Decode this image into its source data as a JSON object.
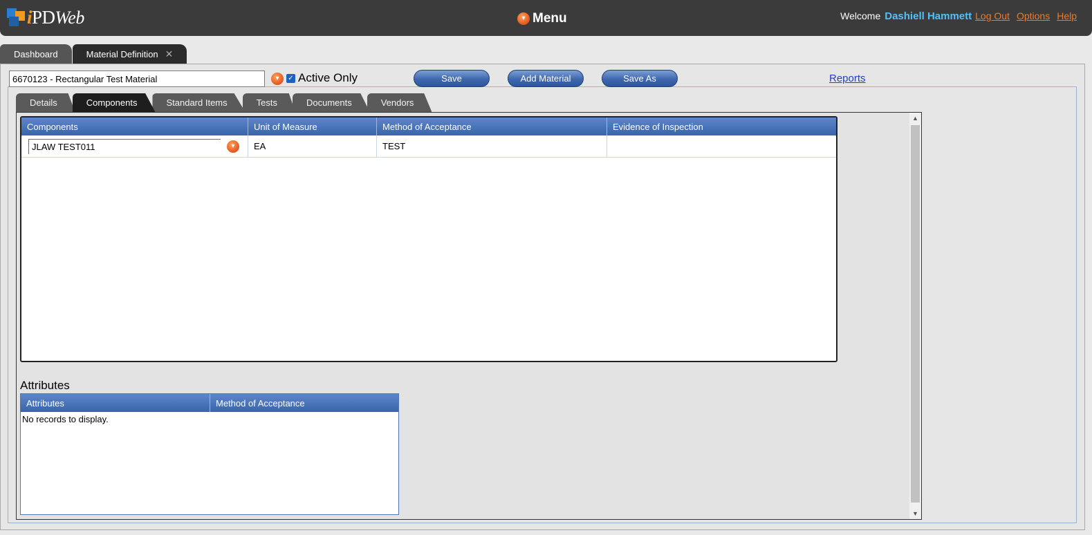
{
  "header": {
    "logo_i": "i",
    "logo_pd": "PD",
    "logo_web": "Web",
    "menu_label": "Menu",
    "welcome_label": "Welcome",
    "user_name": "Dashiell Hammett",
    "links": {
      "logout": "Log Out",
      "options": "Options",
      "help": "Help"
    }
  },
  "top_tabs": [
    {
      "label": "Dashboard",
      "active": false
    },
    {
      "label": "Material Definition",
      "active": true,
      "close": "✕"
    }
  ],
  "toolbar": {
    "material_value": "6670123 - Rectangular Test Material",
    "active_only_label": "Active Only",
    "active_only_checked": true,
    "save_label": "Save",
    "add_material_label": "Add Material",
    "save_as_label": "Save As",
    "reports_label": "Reports"
  },
  "sub_tabs": [
    {
      "label": "Details",
      "active": false
    },
    {
      "label": "Components",
      "active": true
    },
    {
      "label": "Standard Items",
      "active": false
    },
    {
      "label": "Tests",
      "active": false
    },
    {
      "label": "Documents",
      "active": false
    },
    {
      "label": "Vendors",
      "active": false
    }
  ],
  "components_grid": {
    "columns": [
      "Components",
      "Unit of Measure",
      "Method of Acceptance",
      "Evidence of Inspection"
    ],
    "rows": [
      {
        "component": "JLAW TEST011",
        "uom": "EA",
        "method": "TEST",
        "evidence": ""
      }
    ]
  },
  "attributes": {
    "title": "Attributes",
    "columns": [
      "Attributes",
      "Method of Acceptance"
    ],
    "empty_message": "No records to display."
  }
}
